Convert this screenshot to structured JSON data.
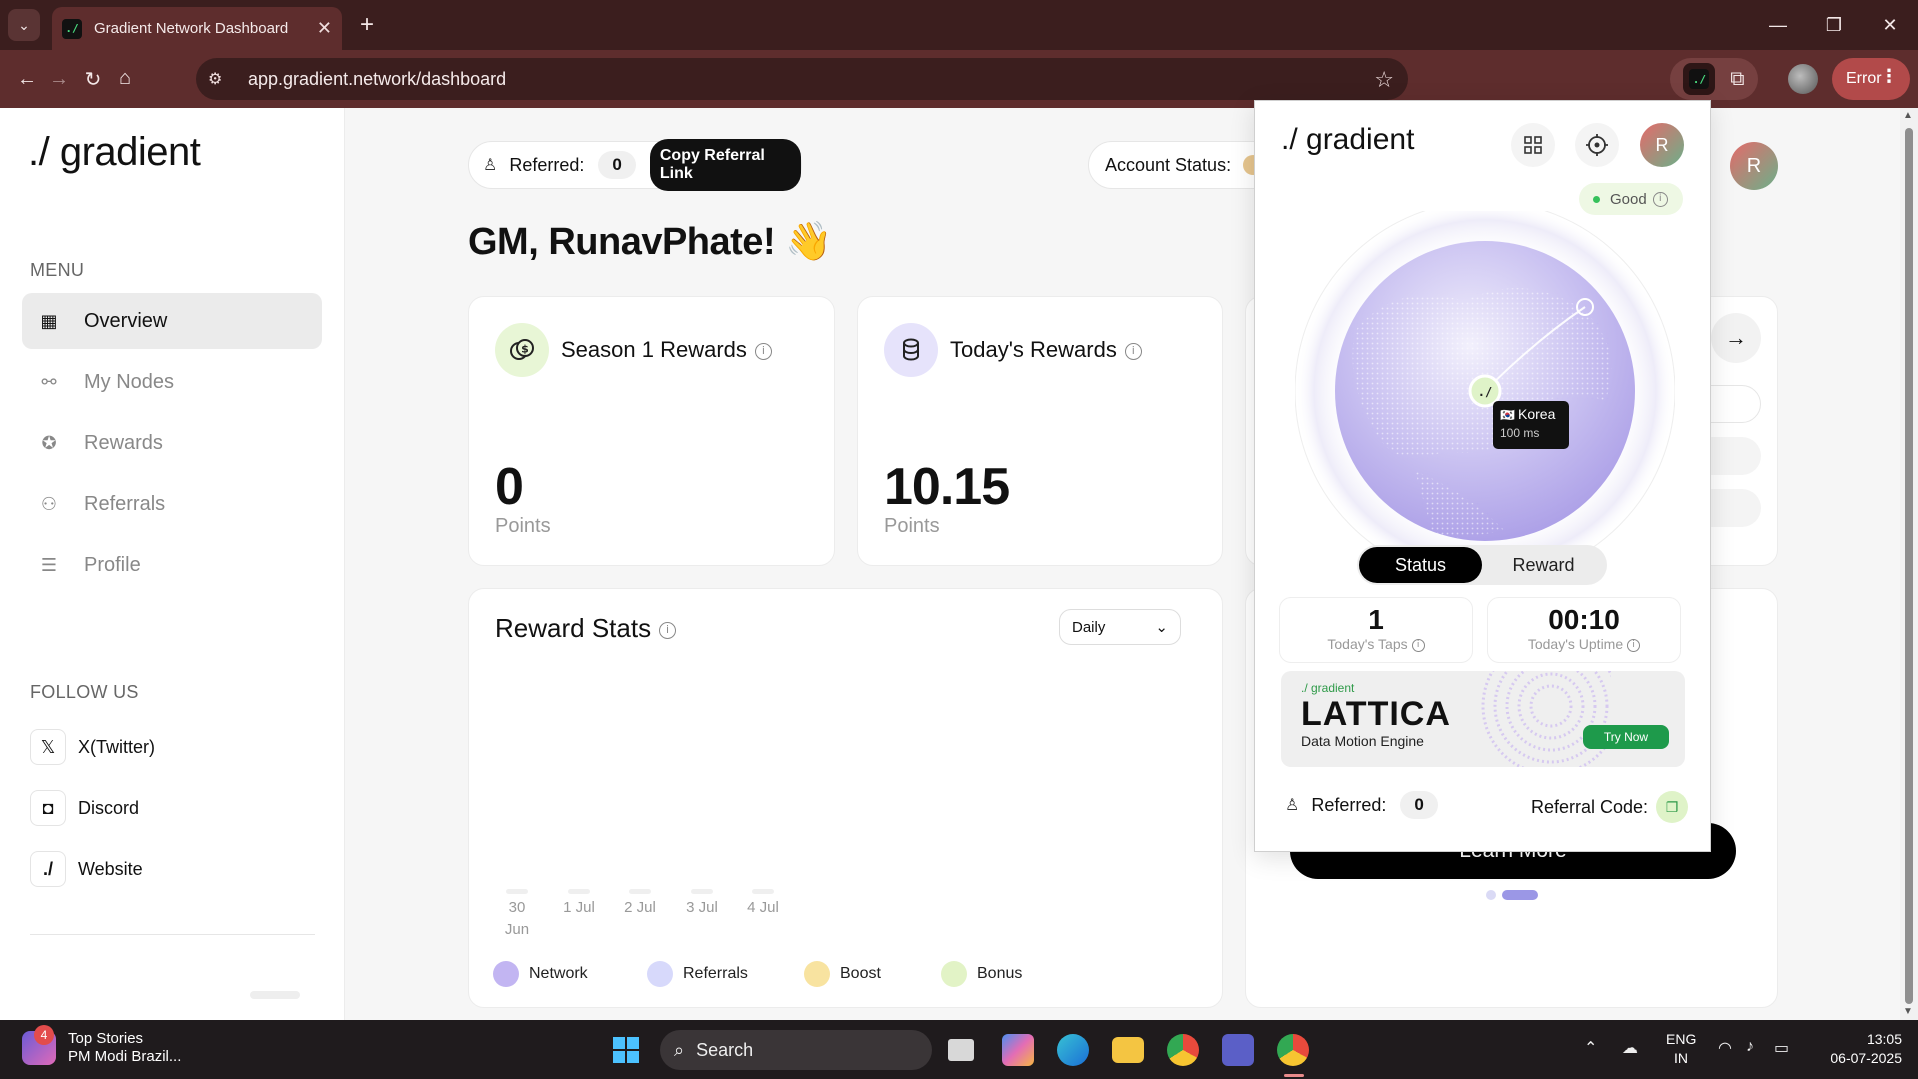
{
  "browser": {
    "tab_title": "Gradient Network Dashboard",
    "tab_favicon": "./",
    "url": "app.gradient.network/dashboard",
    "error_label": "Error",
    "icons": {
      "back": "arrow-left-icon",
      "forward": "arrow-right-icon",
      "reload": "reload-icon",
      "home": "home-icon",
      "site_info": "tune-icon",
      "bookmark": "star-icon",
      "extensions": "puzzle-icon",
      "new_tab": "plus-icon"
    }
  },
  "sidebar": {
    "logo": "./ gradient",
    "menu_heading": "MENU",
    "menu": [
      {
        "label": "Overview",
        "icon": "grid-icon",
        "active": true
      },
      {
        "label": "My Nodes",
        "icon": "nodes-icon",
        "active": false
      },
      {
        "label": "Rewards",
        "icon": "award-icon",
        "active": false
      },
      {
        "label": "Referrals",
        "icon": "users-icon",
        "active": false
      },
      {
        "label": "Profile",
        "icon": "sliders-icon",
        "active": false
      }
    ],
    "follow_heading": "FOLLOW US",
    "follow": [
      {
        "label": "X(Twitter)",
        "icon": "x-logo-icon",
        "glyph": "𝕏"
      },
      {
        "label": "Discord",
        "icon": "discord-icon",
        "glyph": "◘"
      },
      {
        "label": "Website",
        "icon": "gradient-logo-icon",
        "glyph": "./"
      }
    ]
  },
  "header": {
    "referred_label": "Referred:",
    "referred_count": "0",
    "copy_referral_label": "Copy Referral Link",
    "account_status_label": "Account Status:"
  },
  "greeting": "GM, RunavPhate! 👋",
  "cards": {
    "season": {
      "title": "Season 1 Rewards",
      "value": "0",
      "unit": "Points",
      "icon": "coin-dollar-icon"
    },
    "today": {
      "title": "Today's Rewards",
      "value": "10.15",
      "unit": "Points",
      "icon": "coin-stack-icon"
    }
  },
  "reward_stats": {
    "title": "Reward Stats",
    "period": "Daily",
    "x_ticks": [
      [
        "30",
        "Jun"
      ],
      [
        "1 Jul"
      ],
      [
        "2 Jul"
      ],
      [
        "3 Jul"
      ],
      [
        "4 Jul"
      ]
    ],
    "legend": [
      {
        "label": "Network",
        "color": "#c2b5f2"
      },
      {
        "label": "Referrals",
        "color": "#d7d9fb"
      },
      {
        "label": "Boost",
        "color": "#f8e3a0"
      },
      {
        "label": "Bonus",
        "color": "#e2f3c6"
      }
    ]
  },
  "learn_more_label": "Learn More",
  "avatar_initial": "R",
  "popup": {
    "logo": "./ gradient",
    "avatar_initial": "R",
    "status_label": "Good",
    "location": {
      "flag": "🇰🇷",
      "name": "Korea",
      "latency": "100 ms"
    },
    "node_marker": "./",
    "tabs": [
      "Status",
      "Reward"
    ],
    "active_tab": "Status",
    "stats": [
      {
        "value": "1",
        "label": "Today's Taps"
      },
      {
        "value": "00:10",
        "label": "Today's Uptime"
      }
    ],
    "promo": {
      "brand": "./ gradient",
      "title": "LATTICA",
      "subtitle": "Data Motion Engine",
      "cta": "Try Now"
    },
    "referred_label": "Referred:",
    "referred_count": "0",
    "referral_code_label": "Referral Code:"
  },
  "taskbar": {
    "news_title": "Top Stories",
    "news_sub": "PM Modi Brazil...",
    "news_badge": "4",
    "search_label": "Search",
    "lang_top": "ENG",
    "lang_bottom": "IN",
    "time": "13:05",
    "date": "06-07-2025"
  }
}
